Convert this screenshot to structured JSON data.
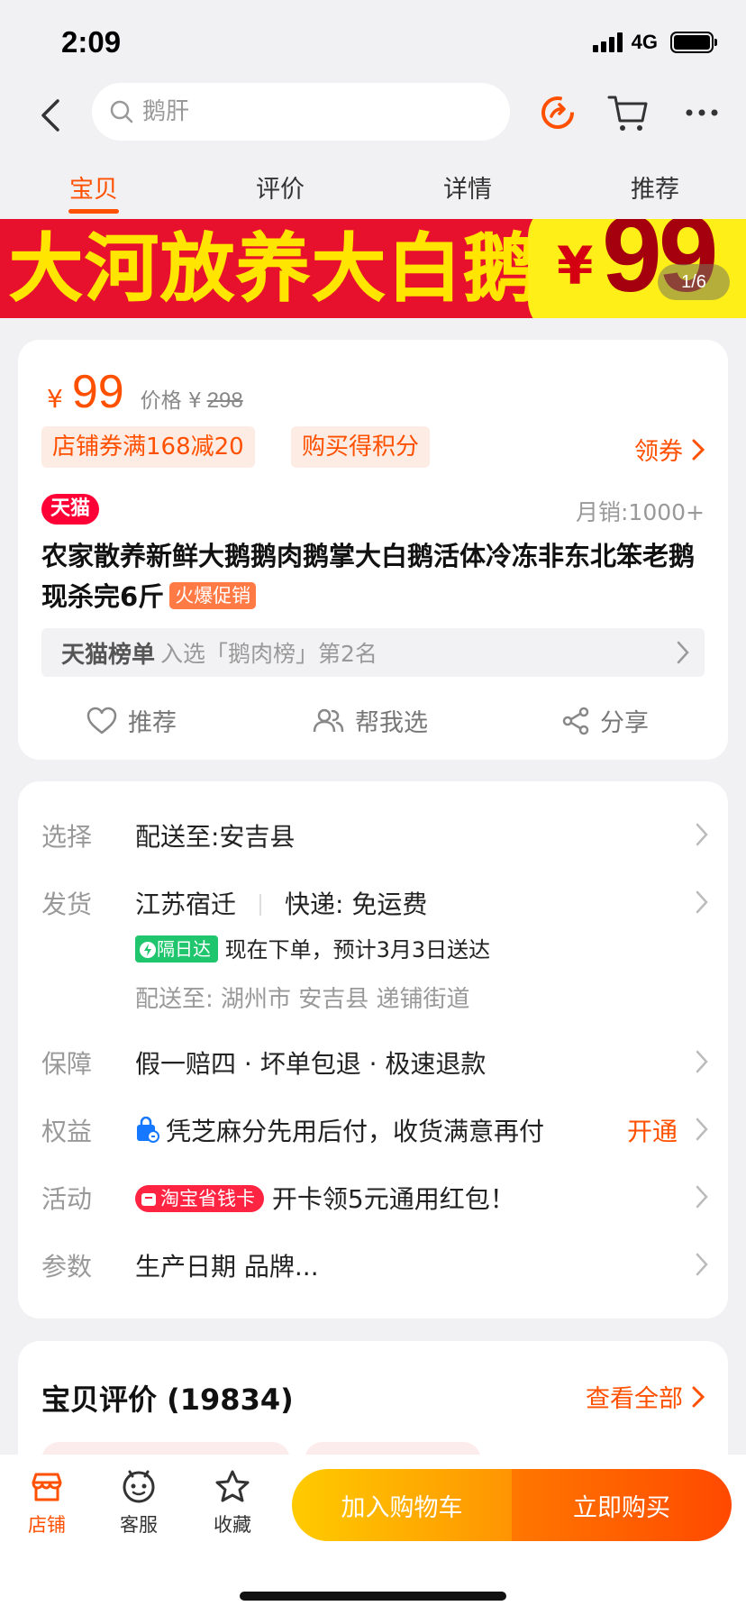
{
  "status": {
    "time": "2:09",
    "network": "4G"
  },
  "nav": {
    "search_placeholder": "鹅肝"
  },
  "tabs": [
    "宝贝",
    "评价",
    "详情",
    "推荐"
  ],
  "banner": {
    "text": "大河放养大白鹅",
    "yen": "¥",
    "price": "99",
    "counter": "1/6"
  },
  "product": {
    "currency": "¥",
    "price": "99",
    "orig_label": "价格 ¥",
    "orig_price": "298",
    "tags": [
      "店铺券满168减20",
      "购买得积分"
    ],
    "coupon_link": "领券",
    "tmall_badge": "天猫",
    "monthly_sales": "月销:1000+",
    "title": "农家散养新鲜大鹅鹅肉鹅掌大白鹅活体冷冻非东北笨老鹅现杀完6斤",
    "hot_tag": "火爆促销",
    "rank_title": "天猫榜单",
    "rank_desc": "入选「鹅肉榜」第2名",
    "actions": [
      "推荐",
      "帮我选",
      "分享"
    ]
  },
  "info": {
    "select_label": "选择",
    "select_value": "配送至:安吉县",
    "ship_label": "发货",
    "ship_origin": "江苏宿迁",
    "ship_method": "快递: 免运费",
    "next_day_badge": "隔日达",
    "delivery_estimate": "现在下单，预计3月3日送达",
    "deliver_to": "配送至: 湖州市 安吉县 递铺街道",
    "guarantee_label": "保障",
    "guarantee_value": "假一赔四 · 坏单包退 · 极速退款",
    "rights_label": "权益",
    "rights_value": "凭芝麻分先用后付，收货满意再付",
    "rights_link": "开通",
    "activity_label": "活动",
    "activity_badge": "淘宝省钱卡",
    "activity_value": "开卡领5元通用红包！",
    "params_label": "参数",
    "params_value": "生产日期 品牌..."
  },
  "reviews": {
    "title": "宝贝评价 (19834)",
    "view_all": "查看全部"
  },
  "bottom": {
    "shop": "店铺",
    "service": "客服",
    "favorite": "收藏",
    "add_cart": "加入购物车",
    "buy_now": "立即购买"
  },
  "colors": {
    "accent": "#ff5000",
    "tmall_red": "#ff0036",
    "banner_red": "#e8112d",
    "banner_yellow": "#ffe500"
  }
}
